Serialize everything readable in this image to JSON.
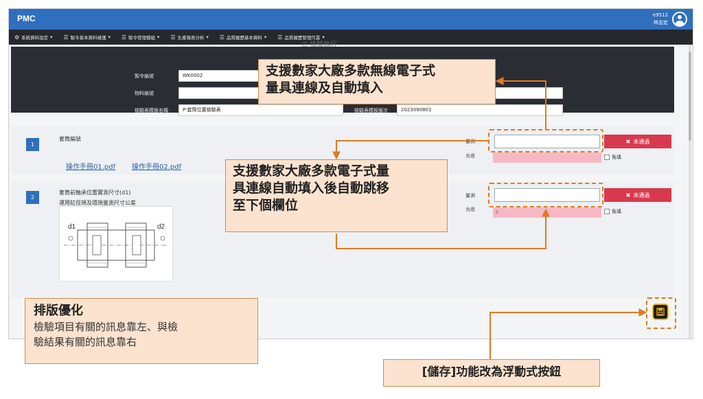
{
  "app": {
    "brand": "PMC",
    "user_id": "e9512",
    "user_name": "林志宏"
  },
  "menu": [
    {
      "icon": "⚙",
      "label": "系統資料設定"
    },
    {
      "icon": "☰",
      "label": "製令基本資料維護"
    },
    {
      "icon": "☰",
      "label": "製令管理模組"
    },
    {
      "icon": "☰",
      "label": "生產報表分析"
    },
    {
      "icon": "☰",
      "label": "品質履歷基本資料"
    },
    {
      "icon": "☰",
      "label": "品質履歷管理作業"
    }
  ],
  "page_title": "檢驗執行",
  "header": {
    "order_label": "製令編號",
    "order_value": "WK0002",
    "material_label": "物料編號",
    "material_value": "",
    "template_label": "檢驗表模版名稱",
    "template_value": "P-套筒位置檢驗表",
    "version_label": "檢驗表模板版次",
    "version_value": "2023090801"
  },
  "items": [
    {
      "number": "1",
      "title": "套筒編號",
      "manuals": [
        "操作手冊01.pdf",
        "操作手冊02.pdf"
      ],
      "measure_label": "量測",
      "allow_label": "允收",
      "allow_value": "",
      "fail_label": "未通過",
      "exempt_label": "免填"
    },
    {
      "number": "2",
      "title_line1": "套筒前軸承位置實測尺寸(d1)",
      "title_line2": "運用缸徑規及環規量測尺寸公差",
      "measure_label": "量測",
      "allow_label": "允收",
      "allow_value": "0",
      "fail_label": "未通過",
      "exempt_label": "免填",
      "drawing_labels": [
        "d1",
        "d2"
      ]
    }
  ],
  "callouts": {
    "wireless": [
      "支援數家大廠多款無線電子式",
      "量具連線及自動填入"
    ],
    "autojump": [
      "支援數家大廠多款電子式量",
      "具連線自動填入後自動跳移",
      "至下個欄位"
    ],
    "layout_title": "排版優化",
    "layout_desc": [
      "檢驗項目有關的訊息靠左、與檢",
      "驗結果有關的訊息靠右"
    ],
    "save": "[儲存]功能改為浮動式按鈕"
  },
  "colors": {
    "topbar": "#2f6fbd",
    "menubar": "#26282d",
    "fail": "#d9394e",
    "allow": "#f6b9c4",
    "callout_fill": "#fbe3cf",
    "callout_line": "#e07a20",
    "fab_border": "#f2b31c"
  }
}
